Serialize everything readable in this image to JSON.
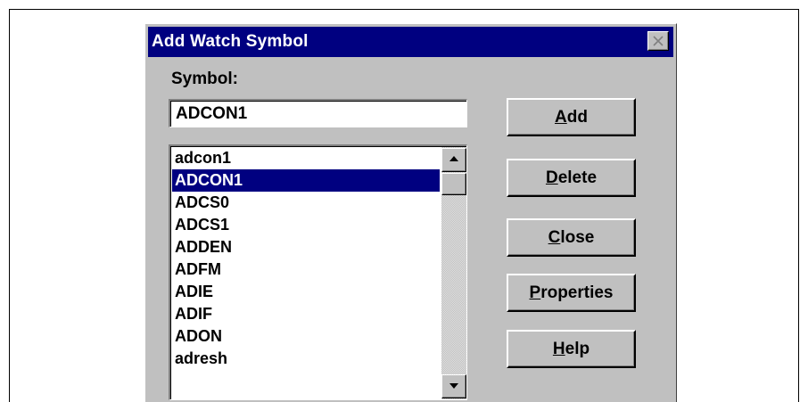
{
  "dialog": {
    "title": "Add Watch Symbol"
  },
  "symbol": {
    "label": "Symbol:",
    "value": "ADCON1"
  },
  "list": {
    "items": [
      "adcon1",
      "ADCON1",
      "ADCS0",
      "ADCS1",
      "ADDEN",
      "ADFM",
      "ADIE",
      "ADIF",
      "ADON",
      "adresh"
    ],
    "selected_index": 1
  },
  "buttons": {
    "add": {
      "accel": "A",
      "rest": "dd"
    },
    "delete": {
      "accel": "D",
      "rest": "elete"
    },
    "close": {
      "accel": "C",
      "rest": "lose"
    },
    "properties": {
      "accel": "P",
      "rest": "roperties"
    },
    "help": {
      "accel": "H",
      "rest": "elp"
    }
  },
  "colors": {
    "titlebar": "#000080",
    "dialog_bg": "#c0c0c0",
    "selection": "#000080"
  },
  "icons": {
    "close": "close-x-icon",
    "scroll_up": "arrow-up-icon",
    "scroll_down": "arrow-down-icon"
  }
}
